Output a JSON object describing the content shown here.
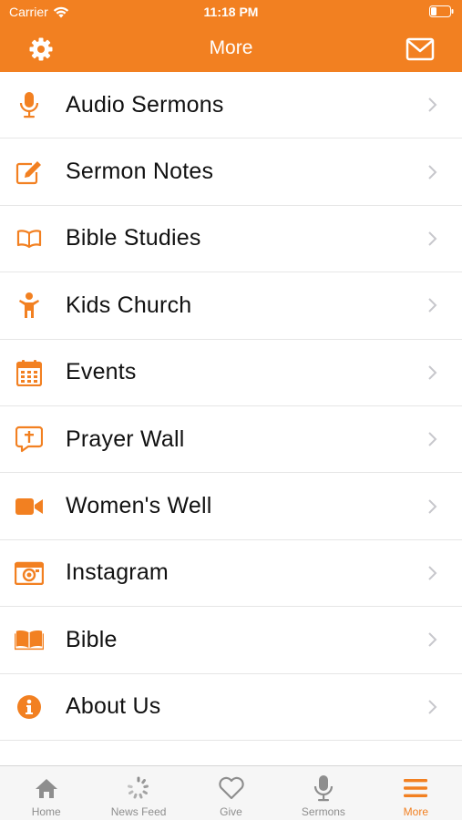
{
  "status_bar": {
    "carrier": "Carrier",
    "time": "11:18 PM"
  },
  "nav": {
    "title": "More",
    "left_icon": "gear-icon",
    "right_icon": "envelope-icon"
  },
  "menu": {
    "items": [
      {
        "label": "Audio Sermons",
        "icon": "microphone-icon"
      },
      {
        "label": "Sermon Notes",
        "icon": "edit-icon"
      },
      {
        "label": "Bible Studies",
        "icon": "open-book-icon"
      },
      {
        "label": "Kids Church",
        "icon": "child-icon"
      },
      {
        "label": "Events",
        "icon": "calendar-icon"
      },
      {
        "label": "Prayer Wall",
        "icon": "prayer-bubble-icon"
      },
      {
        "label": "Women's Well",
        "icon": "video-camera-icon"
      },
      {
        "label": "Instagram",
        "icon": "camera-icon"
      },
      {
        "label": "Bible",
        "icon": "book-icon"
      },
      {
        "label": "About Us",
        "icon": "info-icon"
      }
    ]
  },
  "tabs": [
    {
      "label": "Home",
      "icon": "home-icon",
      "active": false
    },
    {
      "label": "News Feed",
      "icon": "refresh-icon",
      "active": false
    },
    {
      "label": "Give",
      "icon": "heart-icon",
      "active": false
    },
    {
      "label": "Sermons",
      "icon": "microphone-icon",
      "active": false
    },
    {
      "label": "More",
      "icon": "menu-icon",
      "active": true
    }
  ],
  "colors": {
    "accent": "#f28021",
    "tab_inactive": "#8e8e8e",
    "divider": "#e6e6e6"
  }
}
